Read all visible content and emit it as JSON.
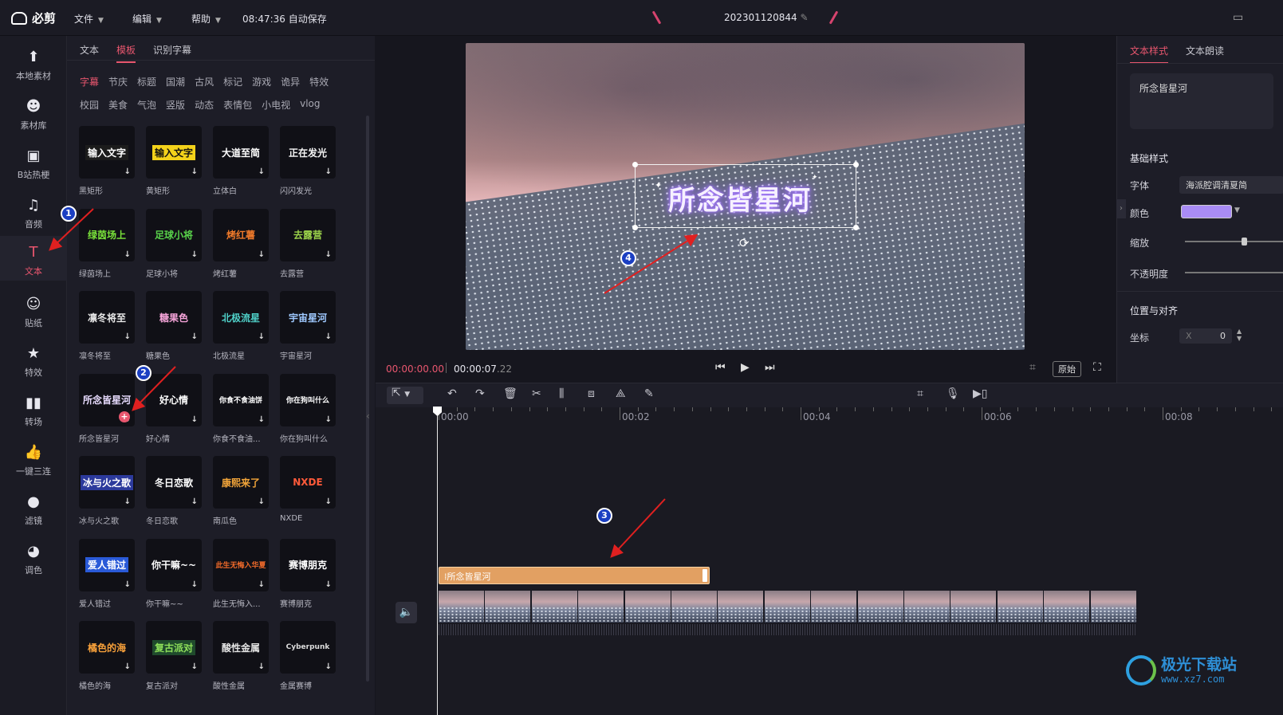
{
  "app": {
    "name": "必剪",
    "save_time": "08:47:36",
    "save_suffix": "自动保存",
    "project": "202301120844"
  },
  "menu": [
    {
      "label": "文件"
    },
    {
      "label": "编辑"
    },
    {
      "label": "帮助"
    }
  ],
  "sidebar": [
    {
      "label": "本地素材",
      "icon": "upload-icon"
    },
    {
      "label": "素材库",
      "icon": "material-icon"
    },
    {
      "label": "B站热梗",
      "icon": "bilibili-icon"
    },
    {
      "label": "音频",
      "icon": "music-icon"
    },
    {
      "label": "文本",
      "icon": "text-icon",
      "active": true
    },
    {
      "label": "贴纸",
      "icon": "sticker-icon"
    },
    {
      "label": "特效",
      "icon": "effect-icon"
    },
    {
      "label": "转场",
      "icon": "transition-icon"
    },
    {
      "label": "一键三连",
      "icon": "thumbs-up-icon"
    },
    {
      "label": "滤镜",
      "icon": "filter-icon"
    },
    {
      "label": "调色",
      "icon": "palette-icon"
    }
  ],
  "panel": {
    "tabs": [
      "文本",
      "模板",
      "识别字幕"
    ],
    "active_tab": "模板",
    "categories_row1": [
      "字幕",
      "节庆",
      "标题",
      "国潮",
      "古风",
      "标记",
      "游戏",
      "诡异",
      "特效"
    ],
    "categories_row2": [
      "校园",
      "美食",
      "气泡",
      "竖版",
      "动态",
      "表情包",
      "小电视",
      "vlog"
    ],
    "templates": [
      {
        "name": "黑矩形",
        "thumb": "输入文字",
        "color": "#ffffff",
        "bg": "#1c1c1c"
      },
      {
        "name": "黄矩形",
        "thumb": "输入文字",
        "color": "#111111",
        "bg": "#f3d21a"
      },
      {
        "name": "立体白",
        "thumb": "大道至简",
        "color": "#ffffff",
        "bg": "#101016"
      },
      {
        "name": "闪闪发光",
        "thumb": "正在发光",
        "color": "#f5f5f5",
        "bg": "#101016"
      },
      {
        "name": "绿茵场上",
        "thumb": "绿茵场上",
        "color": "#7ae33a",
        "bg": "#101016"
      },
      {
        "name": "足球小将",
        "thumb": "足球小将",
        "color": "#58d14a",
        "bg": "#101016"
      },
      {
        "name": "烤红薯",
        "thumb": "烤红薯",
        "color": "#f07a2a",
        "bg": "#101016"
      },
      {
        "name": "去露营",
        "thumb": "去露营",
        "color": "#9bd34a",
        "bg": "#101016"
      },
      {
        "name": "凛冬将至",
        "thumb": "凛冬将至",
        "color": "#e8e8e8",
        "bg": "#101016"
      },
      {
        "name": "糖果色",
        "thumb": "糖果色",
        "color": "#f4a3d8",
        "bg": "#101016"
      },
      {
        "name": "北极流星",
        "thumb": "北极流星",
        "color": "#4fd0c8",
        "bg": "#101016"
      },
      {
        "name": "宇宙星河",
        "thumb": "宇宙星河",
        "color": "#9fc9ff",
        "bg": "#101016"
      },
      {
        "name": "所念皆星河",
        "thumb": "所念皆星河",
        "color": "#e8dcff",
        "bg": "#101016"
      },
      {
        "name": "好心情",
        "thumb": "好心情",
        "color": "#ffffff",
        "bg": "#101016"
      },
      {
        "name": "你食不食油...",
        "thumb": "你食不食油饼",
        "color": "#ffffff",
        "bg": "#101016"
      },
      {
        "name": "你在狗叫什么",
        "thumb": "你在狗叫什么",
        "color": "#ffffff",
        "bg": "#101016"
      },
      {
        "name": "冰与火之歌",
        "thumb": "冰与火之歌",
        "color": "#ffffff",
        "bg": "#2c3a9c"
      },
      {
        "name": "冬日恋歌",
        "thumb": "冬日恋歌",
        "color": "#ffffff",
        "bg": "#101016"
      },
      {
        "name": "南瓜色",
        "thumb": "康熙来了",
        "color": "#f4a63a",
        "bg": "#101016"
      },
      {
        "name": "NXDE",
        "thumb": "NXDE",
        "color": "#ff5a3a",
        "bg": "#101016"
      },
      {
        "name": "爱人错过",
        "thumb": "爱人错过",
        "color": "#ffffff",
        "bg": "#2a5ad8"
      },
      {
        "name": "你干嘛~~",
        "thumb": "你干嘛~~",
        "color": "#ffffff",
        "bg": "#101016"
      },
      {
        "name": "此生无悔入...",
        "thumb": "此生无悔入华夏",
        "color": "#f06a2a",
        "bg": "#101016"
      },
      {
        "name": "赛博朋克",
        "thumb": "赛博朋克",
        "color": "#ffffff",
        "bg": "#101016"
      },
      {
        "name": "橘色的海",
        "thumb": "橘色的海",
        "color": "#f7a03a",
        "bg": "#101016"
      },
      {
        "name": "复古派对",
        "thumb": "复古派对",
        "color": "#8fe05a",
        "bg": "#1f4a2c"
      },
      {
        "name": "酸性金属",
        "thumb": "酸性金属",
        "color": "#e2e2e2",
        "bg": "#101016"
      },
      {
        "name": "金属赛博",
        "thumb": "Cyberpunk",
        "color": "#dcdcdc",
        "bg": "#101016"
      }
    ]
  },
  "preview": {
    "overlay_text": "所念皆星河",
    "time_current": "00:00:00.00",
    "time_total_main": "00:00:07",
    "time_total_frac": ".22",
    "ratio_button": "原始"
  },
  "right_panel": {
    "tabs": [
      "文本样式",
      "文本朗读"
    ],
    "text_value": "所念皆星河",
    "section_basic": "基础样式",
    "font_label": "字体",
    "font_value": "海派腔调清夏简",
    "color_label": "颜色",
    "color_value": "#a98cf5",
    "scale_label": "缩放",
    "scale_value": 0.6,
    "opacity_label": "不透明度",
    "section_pos": "位置与对齐",
    "coord_label": "坐标",
    "coord_x_label": "X",
    "coord_x_value": "0"
  },
  "timeline": {
    "ticks": [
      "00:00",
      "00:02",
      "00:04",
      "00:06",
      "00:08"
    ],
    "text_clip": "所念皆星河"
  },
  "annotations": [
    "1",
    "2",
    "3",
    "4"
  ],
  "watermark": {
    "title": "极光下载站",
    "url": "www.xz7.com"
  }
}
